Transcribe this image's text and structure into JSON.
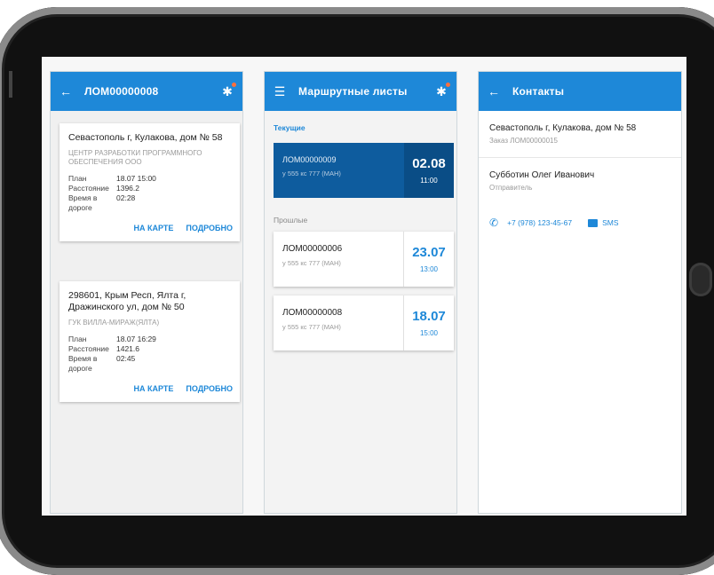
{
  "panel_left": {
    "title": "ЛОМ00000008",
    "cards": [
      {
        "address": "Севастополь г, Кулакова, дом № 58",
        "org": "ЦЕНТР РАЗРАБОТКИ ПРОГРАММНОГО ОБЕСПЕЧЕНИЯ ООО",
        "plan_label": "План",
        "plan": "18.07 15:00",
        "distance_label": "Расстояние",
        "distance": "1396.2",
        "time_label": "Время в дороге",
        "time": "02:28",
        "map_link": "НА КАРТЕ",
        "details_link": "ПОДРОБНО"
      },
      {
        "address": "298601, Крым Респ, Ялта г, Дражинского ул, дом № 50",
        "org": "ГУК ВИЛЛА-МИРАЖ(ЯЛТА)",
        "plan_label": "План",
        "plan": "18.07 16:29",
        "distance_label": "Расстояние",
        "distance": "1421.6",
        "time_label": "Время в дороге",
        "time": "02:45",
        "map_link": "НА КАРТЕ",
        "details_link": "ПОДРОБНО"
      }
    ]
  },
  "panel_middle": {
    "title": "Маршрутные листы",
    "section_current": "Текущие",
    "section_past": "Прошлые",
    "routes": [
      {
        "id": "ЛОМ00000009",
        "car": "у 555 кс 777 (МАН)",
        "date": "02.08",
        "time": "11:00"
      },
      {
        "id": "ЛОМ00000006",
        "car": "у 555 кс 777 (МАН)",
        "date": "23.07",
        "time": "13:00"
      },
      {
        "id": "ЛОМ00000008",
        "car": "у 555 кс 777 (МАН)",
        "date": "18.07",
        "time": "15:00"
      }
    ]
  },
  "panel_right": {
    "title": "Контакты",
    "address": "Севастополь г, Кулакова, дом № 58",
    "order": "Заказ ЛОМ00000015",
    "person": "Субботин Олег Иванович",
    "role": "Отправитель",
    "phone": "+7 (978) 123-45-67",
    "sms": "SMS"
  },
  "colors": {
    "accent": "#1e88d8",
    "current_route_bg": "#0e5c9e"
  },
  "icons": [
    "back-arrow-icon",
    "menu-icon",
    "settings-notify-icon",
    "phone-icon",
    "sms-icon",
    "chevron-right-icon"
  ]
}
